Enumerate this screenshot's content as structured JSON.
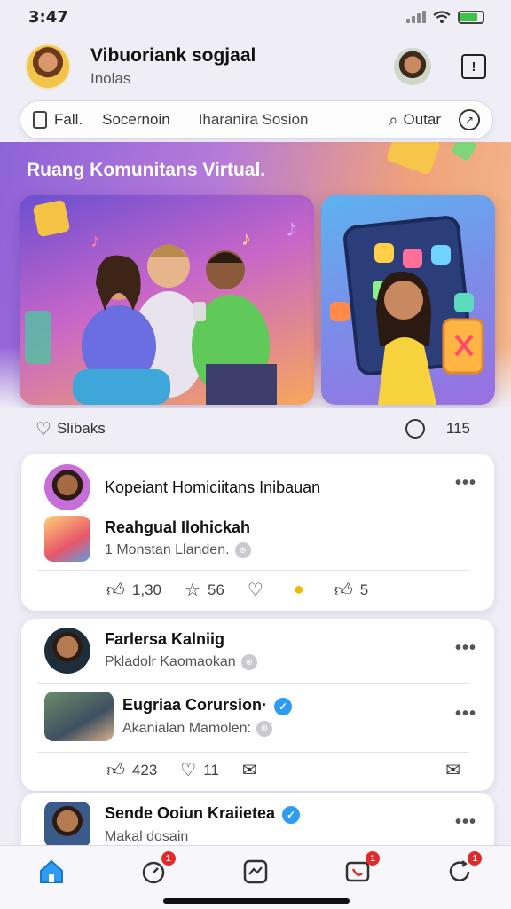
{
  "status_bar": {
    "time": "3:47"
  },
  "header": {
    "title": "Vibuoriank sogjaal",
    "subtitle": "Inolas",
    "notif_glyph": "!"
  },
  "search": {
    "seg1": "Fall.",
    "seg2": "Socernoin",
    "seg3": "Iharanira Sosion",
    "exit": "Outar"
  },
  "hero": {
    "title": "Ruang Komunitans Virtual."
  },
  "engagement": {
    "likes_label": "Slibaks",
    "comments": "115"
  },
  "posts": [
    {
      "header": "Kopeiant Homiciitans Inibauan",
      "title": "Reahgual Ilohickah",
      "subtitle": "1 Monstan Llanden.",
      "stats": {
        "likes": "1,30",
        "stars": "56",
        "bookmarks": "5"
      }
    },
    {
      "header": "Farlersa Kalniig",
      "header_sub": "Pkladolr Kaomaokan",
      "title": "Eugriaa Corursion·",
      "subtitle": "Akanialan Mamolen:",
      "stats": {
        "likes": "423",
        "hearts": "11"
      }
    },
    {
      "title": "Sende Ooiun Kraiietea",
      "subtitle": "Makal dosain"
    }
  ],
  "tabs": [
    {
      "name": "home",
      "badge": ""
    },
    {
      "name": "stopwatch",
      "badge": "1"
    },
    {
      "name": "activity",
      "badge": ""
    },
    {
      "name": "calls",
      "badge": "1"
    },
    {
      "name": "refresh",
      "badge": "1"
    }
  ],
  "colors": {
    "accent": "#2d9cf2",
    "badge": "#e02b2b",
    "hero_start": "#8e63d8",
    "hero_end": "#f4b88a"
  },
  "icons": [
    "search-icon",
    "compass-icon",
    "heart-icon",
    "comment-icon",
    "thumbs-up-icon",
    "star-icon",
    "bookmark-icon",
    "mail-icon",
    "verified-icon",
    "more-icon",
    "home-icon"
  ]
}
